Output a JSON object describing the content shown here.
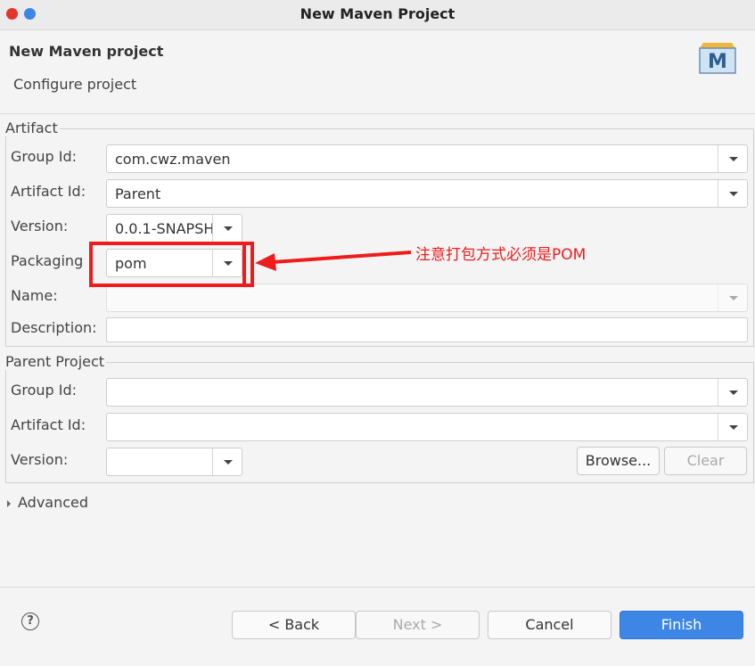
{
  "window": {
    "title": "New Maven Project"
  },
  "header": {
    "title": "New Maven project",
    "subtitle": "Configure project",
    "logo_letter": "M"
  },
  "artifact": {
    "group_label": "Artifact",
    "group_id_label": "Group Id:",
    "group_id_value": "com.cwz.maven",
    "artifact_id_label": "Artifact Id:",
    "artifact_id_value": "Parent",
    "version_label": "Version:",
    "version_value": "0.0.1-SNAPSH",
    "packaging_label": "Packaging",
    "packaging_value": "pom",
    "name_label": "Name:",
    "name_value": "",
    "description_label": "Description:",
    "description_value": ""
  },
  "parent": {
    "group_label": "Parent Project",
    "group_id_label": "Group Id:",
    "group_id_value": "",
    "artifact_id_label": "Artifact Id:",
    "artifact_id_value": "",
    "version_label": "Version:",
    "version_value": "",
    "browse_label": "Browse...",
    "clear_label": "Clear"
  },
  "advanced_label": "Advanced",
  "annotation": {
    "text": "注意打包方式必须是POM",
    "color": "#ee1c1c"
  },
  "footer": {
    "help": "?",
    "back": "< Back",
    "next": "Next >",
    "cancel": "Cancel",
    "finish": "Finish"
  },
  "colors": {
    "accent": "#3e86e6",
    "annotation": "#ee1c1c"
  }
}
